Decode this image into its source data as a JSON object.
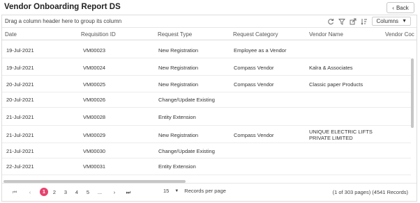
{
  "page": {
    "title": "Vendor Onboarding Report DS",
    "back_label": "Back"
  },
  "grid": {
    "group_hint": "Drag a column header here to group its column",
    "columns_button": "Columns",
    "toolbar_icons": [
      "refresh-icon",
      "filter-icon",
      "export-icon",
      "sort-icon"
    ],
    "headers": [
      "Date",
      "Requisition ID",
      "Request Type",
      "Request Category",
      "Vendor Name",
      "Vendor Coc"
    ],
    "rows": [
      {
        "date": "19-Jul-2021",
        "id": "VM00023",
        "type": "New Registration",
        "category": "Employee as a Vendor",
        "vendor": ""
      },
      {
        "date": "19-Jul-2021",
        "id": "VM00024",
        "type": "New Registration",
        "category": "Compass Vendor",
        "vendor": "Kalra & Associates"
      },
      {
        "date": "20-Jul-2021",
        "id": "VM00025",
        "type": "New Registration",
        "category": "Compass Vendor",
        "vendor": "Classic paper Products"
      },
      {
        "date": "20-Jul-2021",
        "id": "VM00026",
        "type": "Change/Update Existing",
        "category": "",
        "vendor": ""
      },
      {
        "date": "21-Jul-2021",
        "id": "VM00028",
        "type": "Entity Extension",
        "category": "",
        "vendor": ""
      },
      {
        "date": "21-Jul-2021",
        "id": "VM00029",
        "type": "New Registration",
        "category": "Compass Vendor",
        "vendor": "UNIQUE ELECTRIC LIFTS PRIVATE LIMITED"
      },
      {
        "date": "21-Jul-2021",
        "id": "VM00030",
        "type": "Change/Update Existing",
        "category": "",
        "vendor": ""
      },
      {
        "date": "22-Jul-2021",
        "id": "VM00031",
        "type": "Entity Extension",
        "category": "",
        "vendor": ""
      }
    ]
  },
  "pager": {
    "first": "⏮",
    "prev": "‹",
    "pages": [
      "1",
      "2",
      "3",
      "4",
      "5"
    ],
    "ellipsis": "...",
    "next": "›",
    "last": "⏭",
    "per_page_value": "15",
    "per_page_label": "Records per page",
    "summary": "(1 of 303 pages) (4541 Records)",
    "active_page": "1"
  },
  "colors": {
    "accent": "#e7416d"
  }
}
